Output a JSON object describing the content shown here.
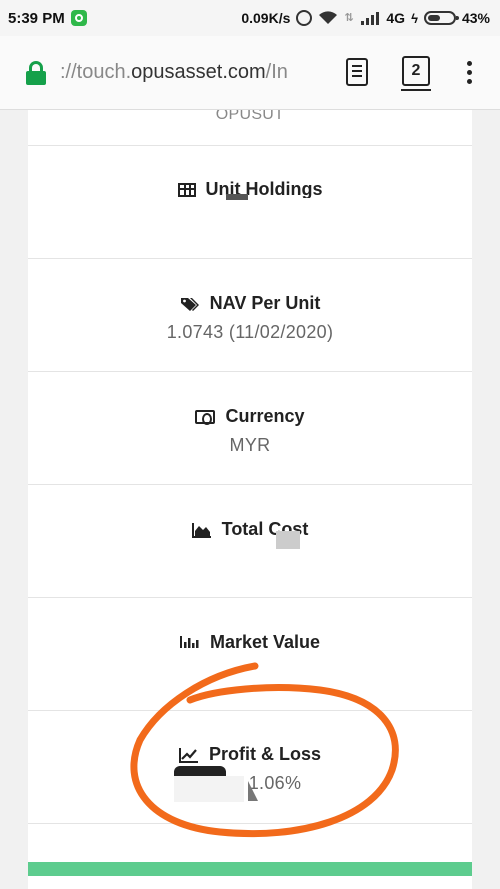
{
  "status_bar": {
    "time": "5:39 PM",
    "speed": "0.09K/s",
    "network": "4G",
    "battery": "43%",
    "icons": [
      "app-notification-icon",
      "alarm-icon",
      "wifi-icon",
      "data-arrows-icon",
      "signal-icon",
      "charging-bolt-icon",
      "battery-icon"
    ]
  },
  "browser": {
    "url_scheme": "://touch.",
    "url_host": "opusasset.com",
    "url_path": "/In",
    "tab_count": "2",
    "icons": [
      "lock-icon",
      "reader-mode-icon",
      "tabs-icon",
      "overflow-menu-icon"
    ]
  },
  "details": {
    "partial_top": "OPUSUT",
    "rows": [
      {
        "label": "Unit Holdings",
        "icon": "grid-icon",
        "value": ""
      },
      {
        "label": "NAV Per Unit",
        "icon": "tags-icon",
        "value": "1.0743 (11/02/2020)"
      },
      {
        "label": "Currency",
        "icon": "money-bill-icon",
        "value": "MYR"
      },
      {
        "label": "Total Cost",
        "icon": "area-chart-icon",
        "value": ""
      },
      {
        "label": "Market Value",
        "icon": "bar-chart-icon",
        "value": ""
      },
      {
        "label": "Profit & Loss",
        "icon": "line-chart-icon",
        "value": "1.06%"
      }
    ]
  },
  "colors": {
    "accent_green": "#5dcc8e",
    "lock_green": "#15a04a",
    "annotation_orange": "#f26a1b"
  }
}
